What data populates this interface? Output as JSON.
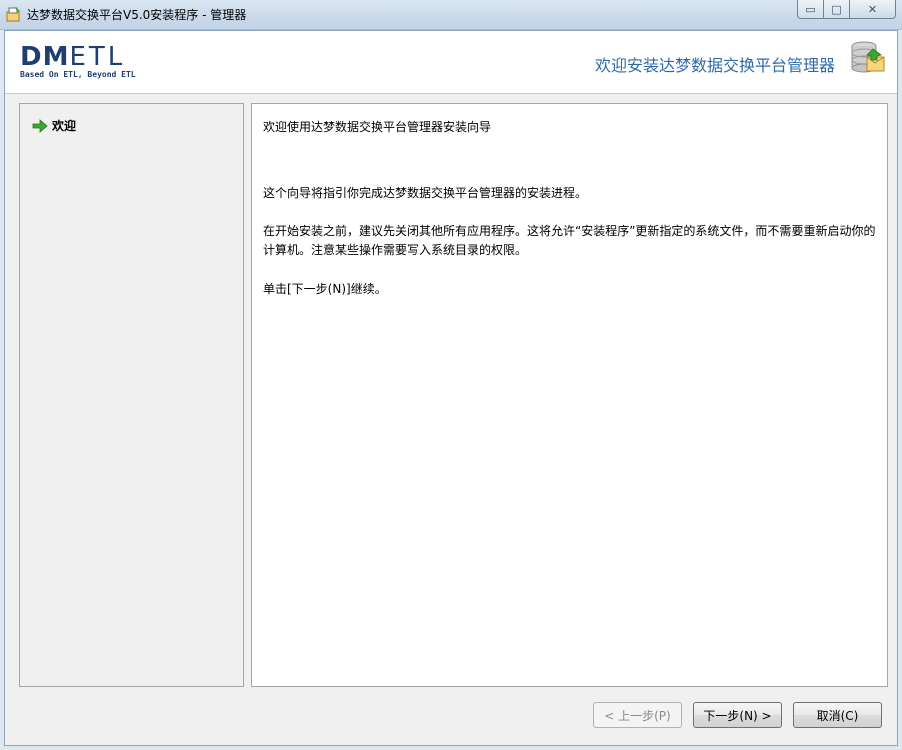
{
  "window": {
    "title": "达梦数据交换平台V5.0安装程序 - 管理器",
    "controls": {
      "minimize": "▭",
      "maximize": "□",
      "close": "✕"
    }
  },
  "header": {
    "logo_main_bold": "DM",
    "logo_main_thin": "ETL",
    "logo_sub": "Based On ETL, Beyond ETL",
    "title": "欢迎安装达梦数据交换平台管理器",
    "icon": "database-install-icon"
  },
  "sidebar": {
    "items": [
      {
        "label": "欢迎",
        "icon": "green-arrow-icon",
        "active": true
      }
    ]
  },
  "content": {
    "heading": "欢迎使用达梦数据交换平台管理器安装向导",
    "paragraph1": "这个向导将指引你完成达梦数据交换平台管理器的安装进程。",
    "paragraph2": "在开始安装之前，建议先关闭其他所有应用程序。这将允许“安装程序”更新指定的系统文件，而不需要重新启动你的计算机。注意某些操作需要写入系统目录的权限。",
    "paragraph3": "单击[下一步(N)]继续。"
  },
  "buttons": {
    "back": "< 上一步(P)",
    "next": "下一步(N) >",
    "cancel": "取消(C)"
  },
  "colors": {
    "accent": "#2e6aa8",
    "logo": "#1f3f70",
    "arrow": "#3aa832"
  }
}
